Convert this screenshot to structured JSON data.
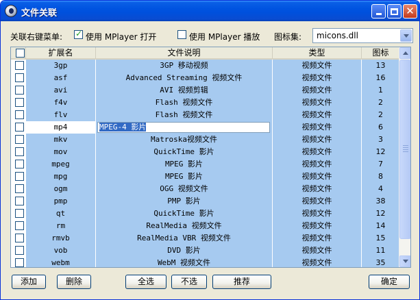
{
  "window": {
    "title": "文件关联"
  },
  "options": {
    "context_menu_label": "关联右键菜单:",
    "open_with_label": "使用 MPlayer 打开",
    "open_with_checked": true,
    "play_with_label": "使用 MPlayer 播放",
    "play_with_checked": false,
    "iconset_label": "图标集:",
    "iconset_value": "micons.dll"
  },
  "table": {
    "columns": [
      "",
      "扩展名",
      "文件说明",
      "类型",
      "图标"
    ],
    "editing_row": 5,
    "rows": [
      {
        "ext": "3gp",
        "desc": "3GP 移动视频",
        "type": "视频文件",
        "icon": "13"
      },
      {
        "ext": "asf",
        "desc": "Advanced Streaming 视频文件",
        "type": "视频文件",
        "icon": "16"
      },
      {
        "ext": "avi",
        "desc": "AVI 视频剪辑",
        "type": "视频文件",
        "icon": "1"
      },
      {
        "ext": "f4v",
        "desc": "Flash 视频文件",
        "type": "视频文件",
        "icon": "2"
      },
      {
        "ext": "flv",
        "desc": "Flash 视频文件",
        "type": "视频文件",
        "icon": "2"
      },
      {
        "ext": "mp4",
        "desc": "MPEG-4 影片",
        "type": "视频文件",
        "icon": "6"
      },
      {
        "ext": "mkv",
        "desc": "Matroska视频文件",
        "type": "视频文件",
        "icon": "3"
      },
      {
        "ext": "mov",
        "desc": "QuickTime 影片",
        "type": "视频文件",
        "icon": "12"
      },
      {
        "ext": "mpeg",
        "desc": "MPEG 影片",
        "type": "视频文件",
        "icon": "7"
      },
      {
        "ext": "mpg",
        "desc": "MPEG 影片",
        "type": "视频文件",
        "icon": "8"
      },
      {
        "ext": "ogm",
        "desc": "OGG 视频文件",
        "type": "视频文件",
        "icon": "4"
      },
      {
        "ext": "pmp",
        "desc": "PMP 影片",
        "type": "视频文件",
        "icon": "38"
      },
      {
        "ext": "qt",
        "desc": "QuickTime 影片",
        "type": "视频文件",
        "icon": "12"
      },
      {
        "ext": "rm",
        "desc": "RealMedia 视频文件",
        "type": "视频文件",
        "icon": "14"
      },
      {
        "ext": "rmvb",
        "desc": "RealMedia VBR 视频文件",
        "type": "视频文件",
        "icon": "15"
      },
      {
        "ext": "vob",
        "desc": "DVD 影片",
        "type": "视频文件",
        "icon": "11"
      },
      {
        "ext": "webm",
        "desc": "WebM 视频文件",
        "type": "视频文件",
        "icon": "35"
      }
    ]
  },
  "buttons": {
    "add": "添加",
    "delete": "删除",
    "select_all": "全选",
    "select_none": "不选",
    "recommend": "推荐",
    "ok": "确定"
  }
}
